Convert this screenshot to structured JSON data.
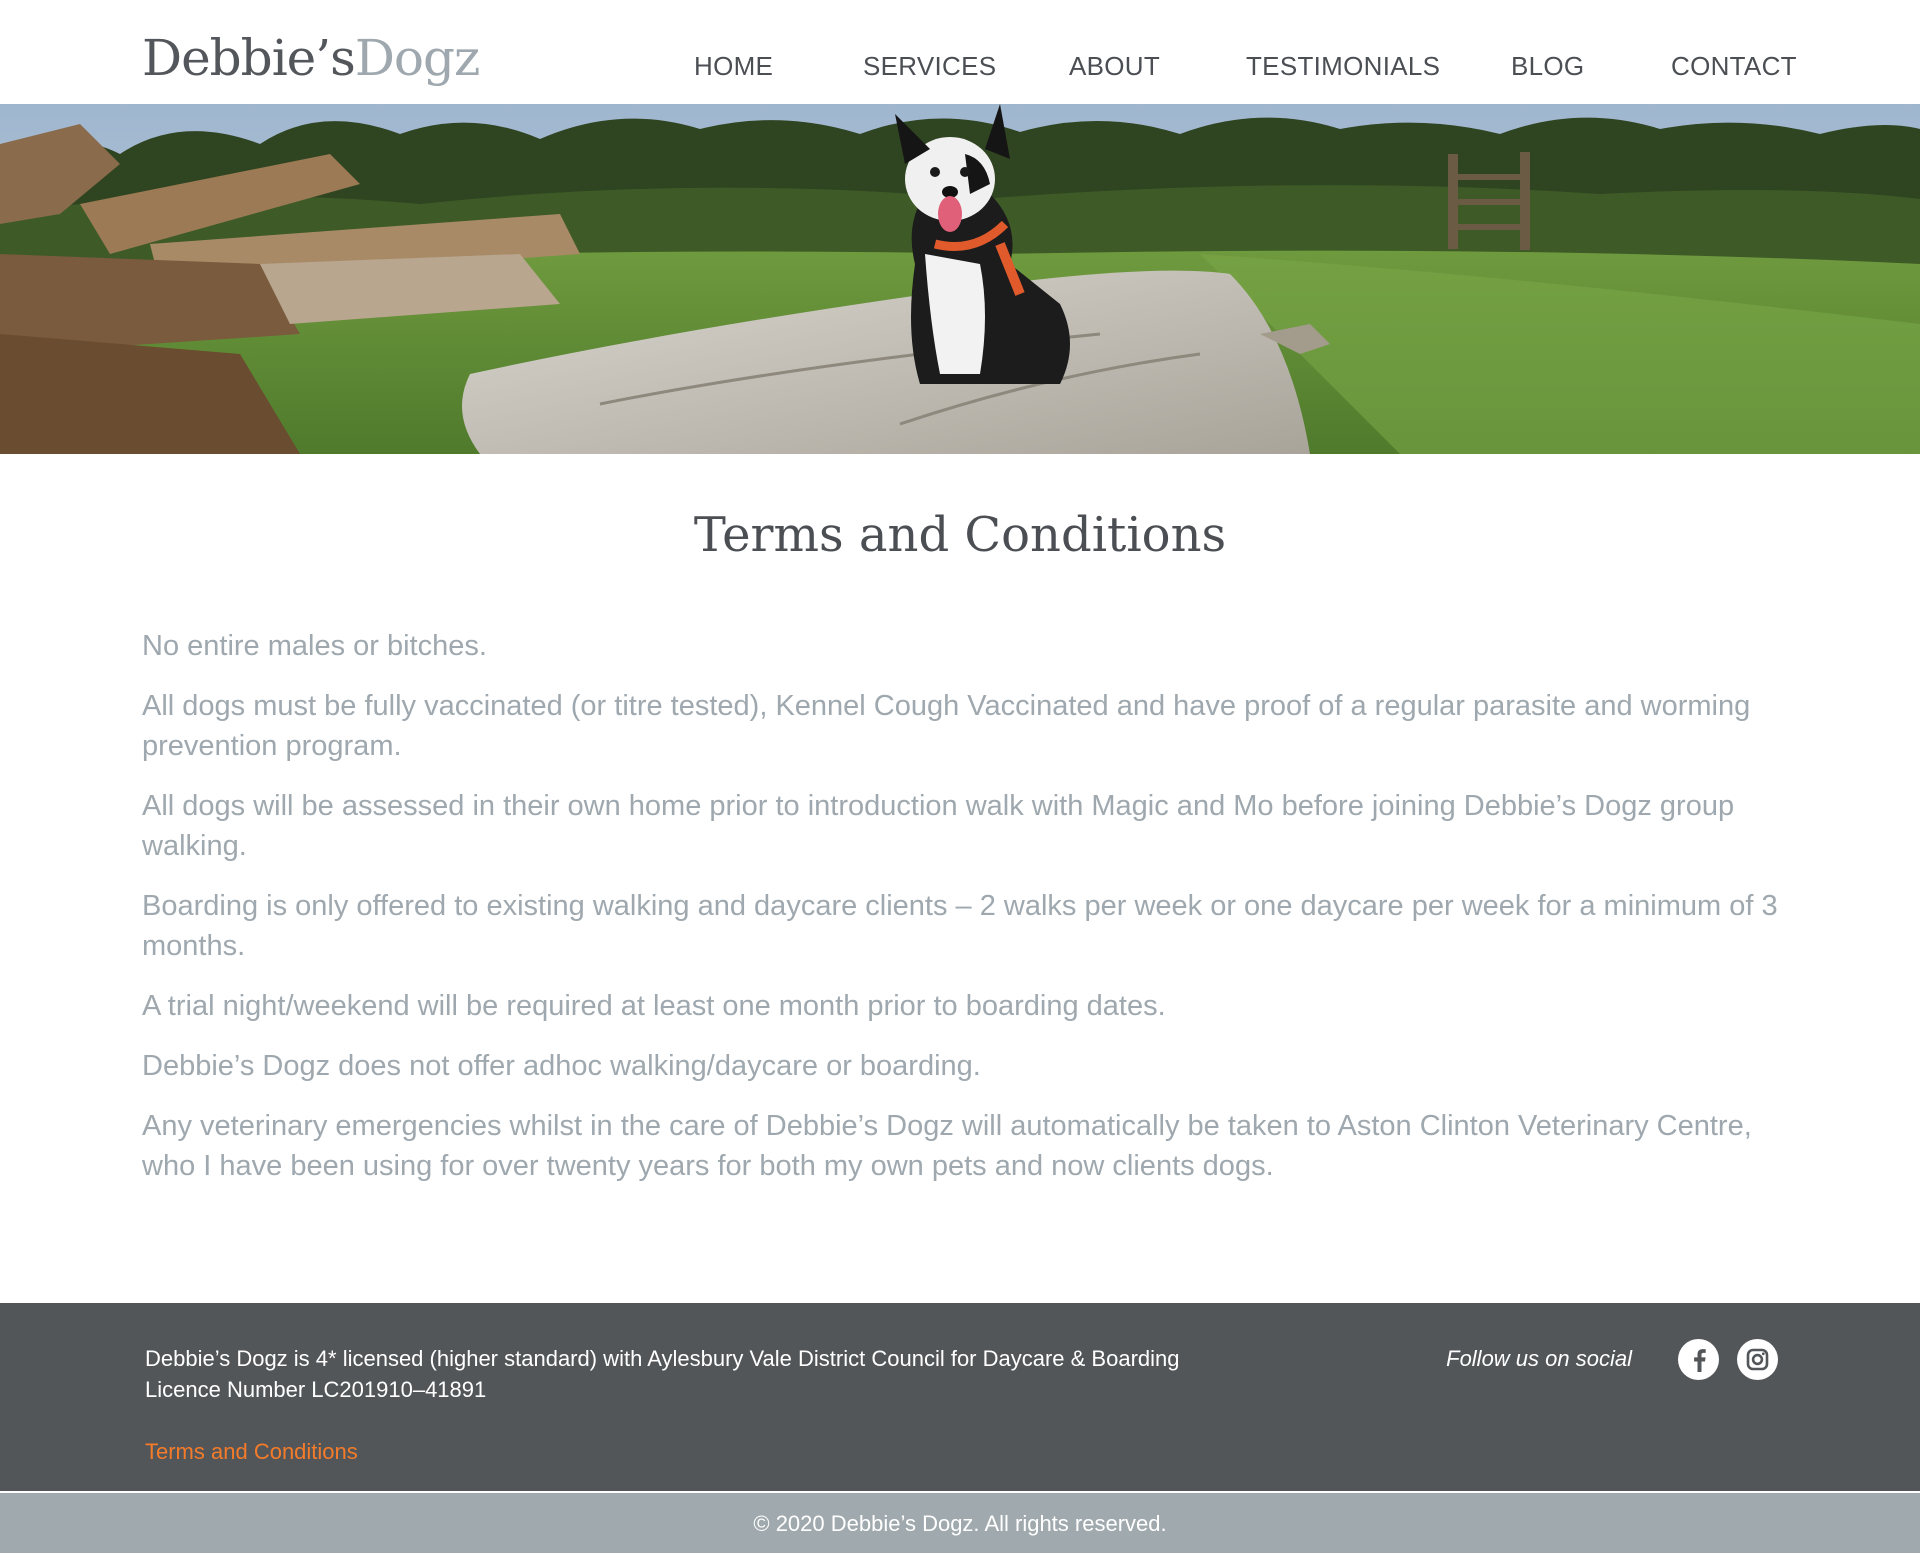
{
  "header": {
    "logo": {
      "part1": "Debbie’s",
      "part2": "Dogz"
    },
    "nav": [
      {
        "label": "HOME"
      },
      {
        "label": "SERVICES"
      },
      {
        "label": "ABOUT"
      },
      {
        "label": "TESTIMONIALS"
      },
      {
        "label": "BLOG"
      },
      {
        "label": "CONTACT"
      }
    ]
  },
  "hero": {
    "image": "black-and-white-dog-sitting-on-log-in-field"
  },
  "main": {
    "title": "Terms and Conditions",
    "terms": [
      "No entire males or bitches.",
      "All dogs must be fully vaccinated (or titre tested), Kennel Cough Vaccinated and have proof of a regular parasite and worming prevention program.",
      "All dogs will be assessed in their own home prior to introduction walk with Magic and Mo before joining Debbie’s Dogz group walking.",
      "Boarding is only offered to existing walking and daycare clients – 2 walks per week or one daycare per week for a minimum of 3 months.",
      "A trial night/weekend will be required at least one month prior to boarding dates.",
      "Debbie’s Dogz does not offer adhoc walking/daycare or boarding.",
      "Any veterinary emergencies whilst in the care of Debbie’s Dogz will automatically be taken to Aston Clinton Veterinary Centre, who I have been using for over twenty years for both my own pets and now clients dogs."
    ]
  },
  "footer": {
    "licence_line1": "Debbie’s Dogz is 4* licensed (higher standard) with Aylesbury Vale District Council for Daycare & Boarding",
    "licence_line2": "Licence Number LC201910–41891",
    "terms_link": "Terms and Conditions",
    "follow_text": "Follow us on social",
    "social": [
      {
        "icon": "facebook-icon"
      },
      {
        "icon": "instagram-icon"
      }
    ],
    "copyright": "© 2020 Debbie’s Dogz. All rights reserved."
  },
  "colors": {
    "text_dark": "#4b4f54",
    "text_muted": "#9ea8ae",
    "footer_bg": "#525659",
    "bottom_bar_bg": "#a0a9ad",
    "accent": "#f47b2a"
  }
}
